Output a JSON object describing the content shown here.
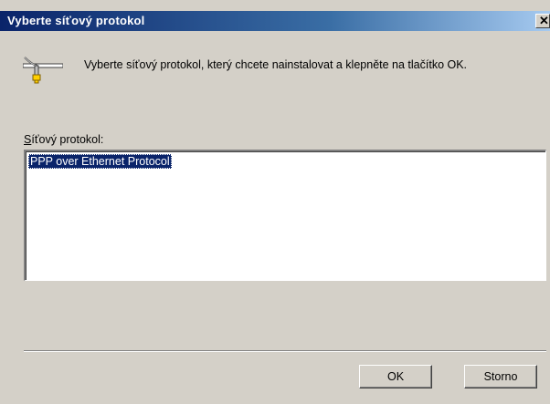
{
  "window": {
    "title": "Vyberte síťový protokol",
    "close_glyph": "✕",
    "icon": "network-protocol-icon"
  },
  "dialog": {
    "instruction": "Vyberte síťový protokol, který chcete nainstalovat a klepněte na tlačítko OK.",
    "list_label_accesskey": "S",
    "list_label_rest": "íťový protokol:",
    "protocols": [
      {
        "label": "PPP over Ethernet Protocol",
        "selected": true
      }
    ]
  },
  "buttons": {
    "ok_label": "OK",
    "cancel_label": "Storno"
  },
  "colors": {
    "titlebar_start": "#0a246a",
    "titlebar_end": "#a6caf0",
    "face": "#d4d0c8",
    "selection": "#0a246a"
  }
}
